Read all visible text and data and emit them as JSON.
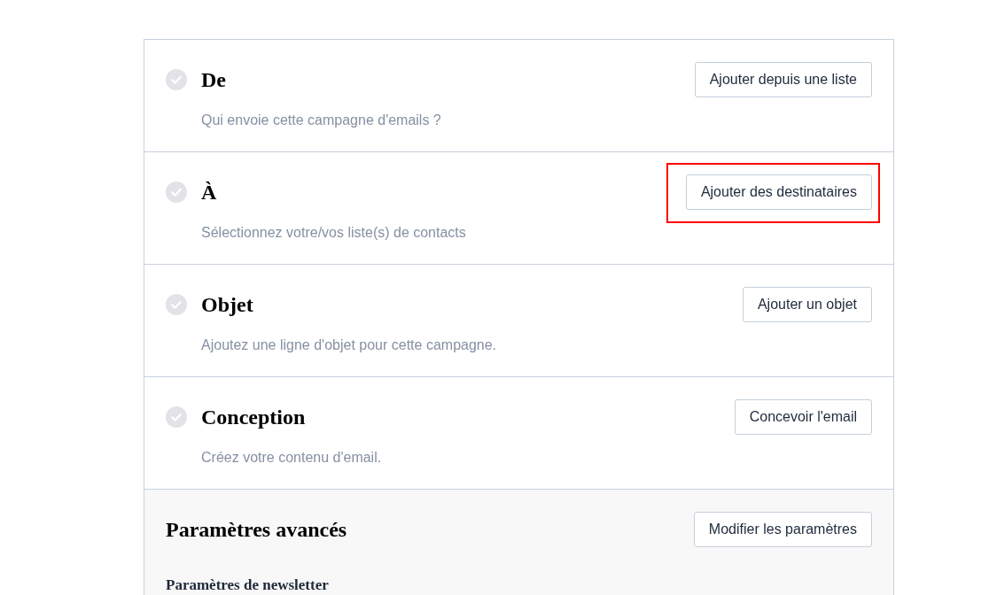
{
  "steps": [
    {
      "title": "De",
      "description": "Qui envoie cette campagne d'emails ?",
      "button": "Ajouter depuis une liste",
      "completed": false,
      "highlighted": false
    },
    {
      "title": "À",
      "description": "Sélectionnez votre/vos liste(s) de contacts",
      "button": "Ajouter des destinataires",
      "completed": false,
      "highlighted": true
    },
    {
      "title": "Objet",
      "description": "Ajoutez une ligne d'objet pour cette campagne.",
      "button": "Ajouter un objet",
      "completed": false,
      "highlighted": false
    },
    {
      "title": "Conception",
      "description": "Créez votre contenu d'email.",
      "button": "Concevoir l'email",
      "completed": false,
      "highlighted": false
    }
  ],
  "advanced": {
    "title": "Paramètres avancés",
    "button": "Modifier les paramètres",
    "subsection_title": "Paramètres de newsletter"
  }
}
